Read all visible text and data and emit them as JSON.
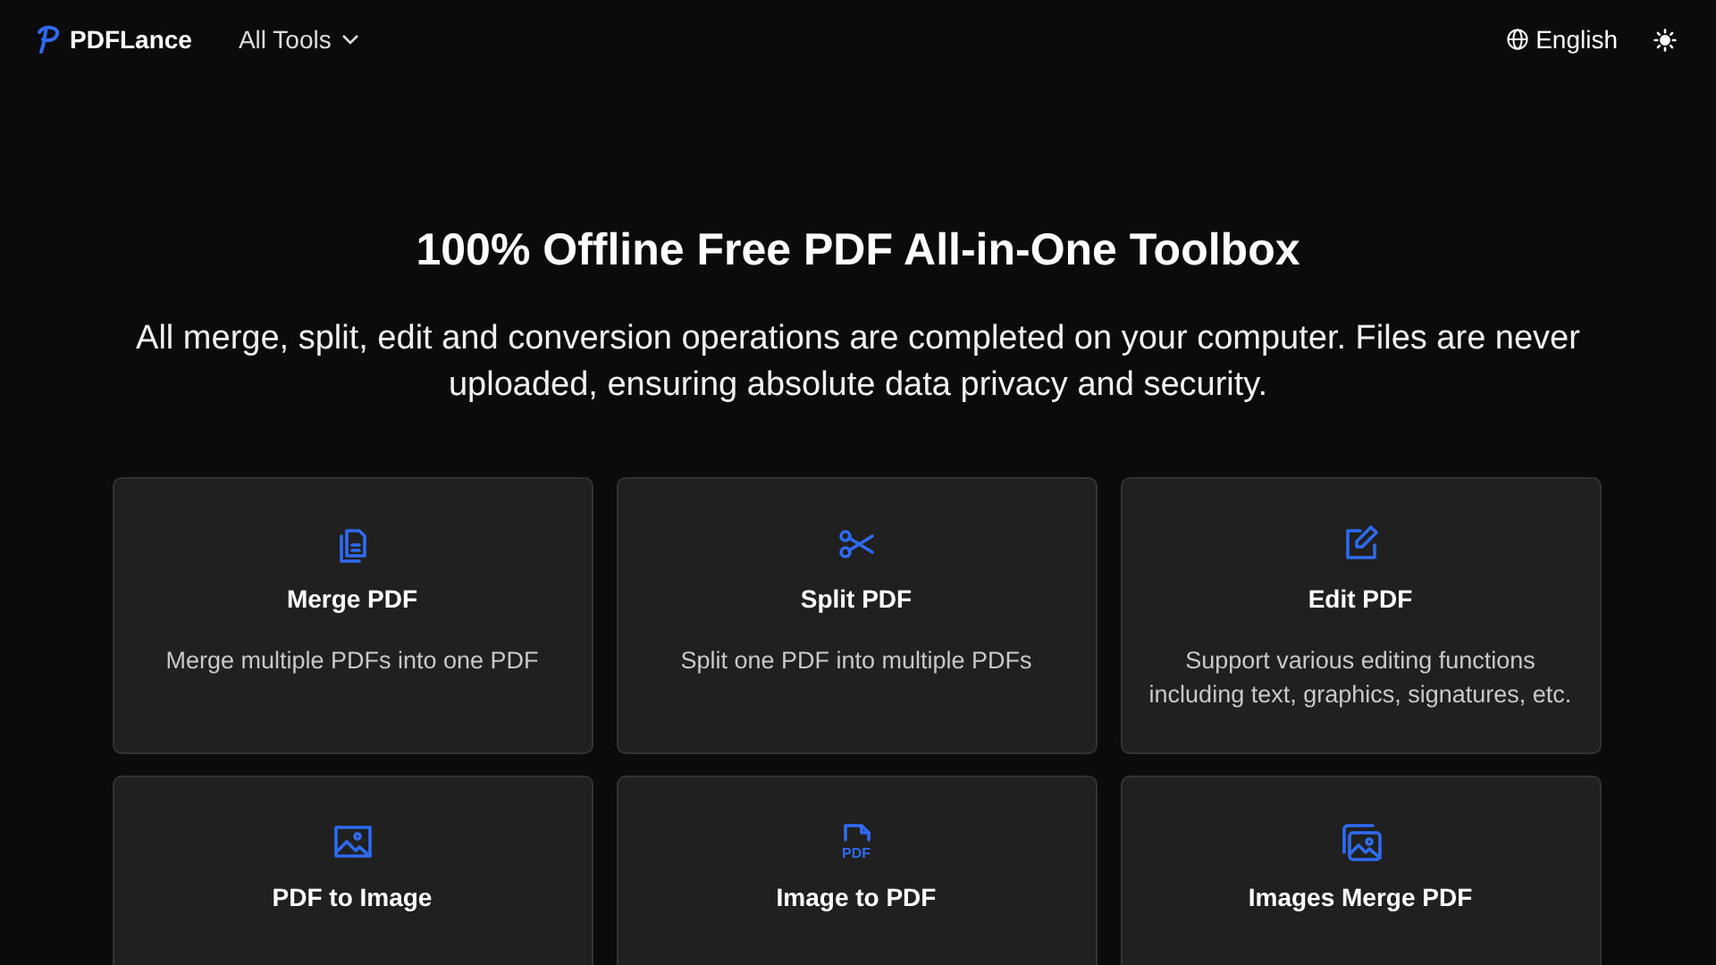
{
  "header": {
    "brand": "PDFLance",
    "menu": "All Tools",
    "language": "English"
  },
  "hero": {
    "title": "100% Offline Free PDF All-in-One Toolbox",
    "subtitle": "All merge, split, edit and conversion operations are completed on your computer. Files are never uploaded, ensuring absolute data privacy and security."
  },
  "tools": [
    {
      "kind": "merge",
      "title": "Merge PDF",
      "description": "Merge multiple PDFs into one PDF"
    },
    {
      "kind": "split",
      "title": "Split PDF",
      "description": "Split one PDF into multiple PDFs"
    },
    {
      "kind": "edit",
      "title": "Edit PDF",
      "description": "Support various editing functions including text, graphics, signatures, etc."
    },
    {
      "kind": "image",
      "title": "PDF to Image"
    },
    {
      "kind": "pdf",
      "title": "Image to PDF",
      "icon_label": "PDF"
    },
    {
      "kind": "images",
      "title": "Images Merge PDF"
    }
  ]
}
